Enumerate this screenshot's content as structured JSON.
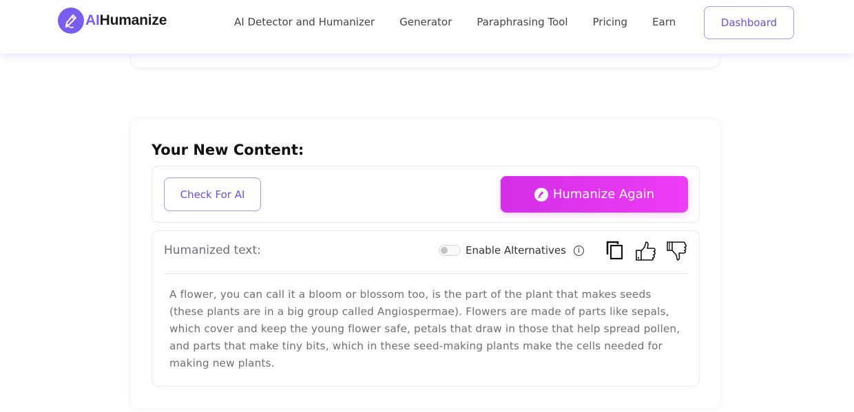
{
  "brand": {
    "logo_prefix": "AI",
    "logo_suffix": "Humanize",
    "logo_icon": "pencil-icon",
    "accent_color": "#7a5cf0",
    "button_gradient": [
      "#d42ee8",
      "#ee3cf5"
    ]
  },
  "nav": {
    "links": [
      {
        "label": "AI Detector and Humanizer"
      },
      {
        "label": "Generator"
      },
      {
        "label": "Paraphrasing Tool"
      },
      {
        "label": "Pricing"
      },
      {
        "label": "Earn"
      }
    ],
    "dashboard_label": "Dashboard"
  },
  "content": {
    "title": "Your New Content:",
    "check_ai_label": "Check For AI",
    "humanize_again_label": "Humanize Again",
    "output": {
      "label": "Humanized text:",
      "alternatives_label": "Enable Alternatives",
      "alternatives_enabled": false,
      "info_icon": "info-icon",
      "actions": [
        "copy-icon",
        "thumbs-up-icon",
        "thumbs-down-icon"
      ],
      "text": "A flower, you can call it a bloom or blossom too, is the part of the plant that makes seeds (these plants are in a big group called Angiospermae). Flowers are made of parts like sepals, which cover and keep the young flower safe, petals that draw in those that help spread pollen, and parts that make tiny bits, which in these seed-making plants make the cells needed for making new plants."
    }
  }
}
